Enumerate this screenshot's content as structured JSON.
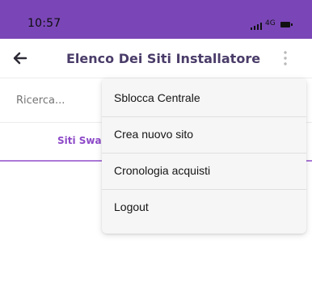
{
  "status_bar": {
    "time": "10:57",
    "network": "4G",
    "background": "#7a46b7"
  },
  "app_bar": {
    "title": "Elenco Dei Siti Installatore",
    "back_icon": "arrow-left-icon",
    "more_icon": "more-vertical-icon"
  },
  "search": {
    "placeholder": "Ricerca..."
  },
  "tabs": [
    {
      "label": "Siti Swa",
      "selected": true
    }
  ],
  "menu": {
    "items": [
      {
        "label": "Sblocca Centrale"
      },
      {
        "label": "Crea nuovo sito"
      },
      {
        "label": "Cronologia acquisti"
      },
      {
        "label": "Logout"
      }
    ]
  }
}
